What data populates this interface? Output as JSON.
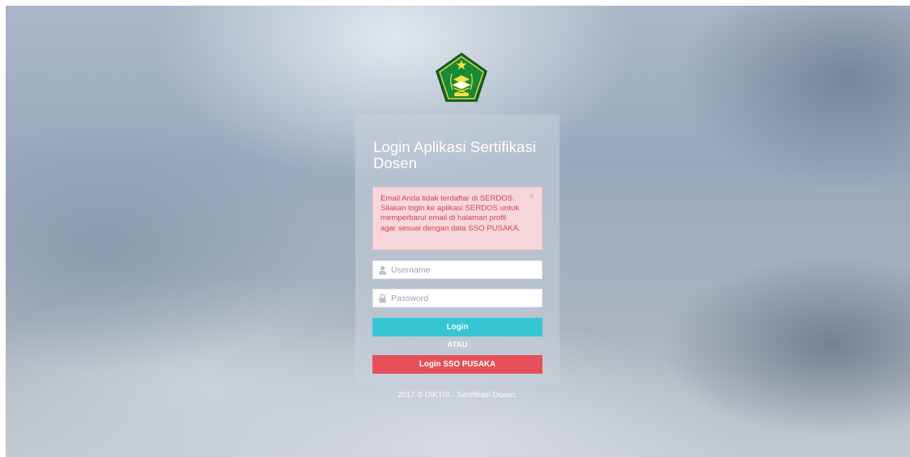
{
  "page": {
    "title": "Login Aplikasi Sertifikasi Dosen"
  },
  "alert": {
    "message": "Email Anda tidak terdaftar di SERDOS. Silakan login ke aplikasi SERDOS untuk memperbarui email di halaman profil agar sesuai dengan data SSO PUSAKA.",
    "close_symbol": "×"
  },
  "form": {
    "username_placeholder": "Username",
    "password_placeholder": "Password",
    "login_label": "Login",
    "divider_label": "ATAU",
    "sso_label": "Login SSO PUSAKA"
  },
  "footer": {
    "copyright": "2017 © DIKTIS - Sertifikasi Dosen."
  },
  "icons": {
    "logo": "kemenag-emblem-logo",
    "username": "user-icon",
    "password": "lock-icon",
    "close": "close-icon"
  },
  "colors": {
    "login_button": "#36c6d3",
    "sso_button": "#e7505a",
    "alert_background": "#f7d7db",
    "alert_text": "#d2454b"
  }
}
